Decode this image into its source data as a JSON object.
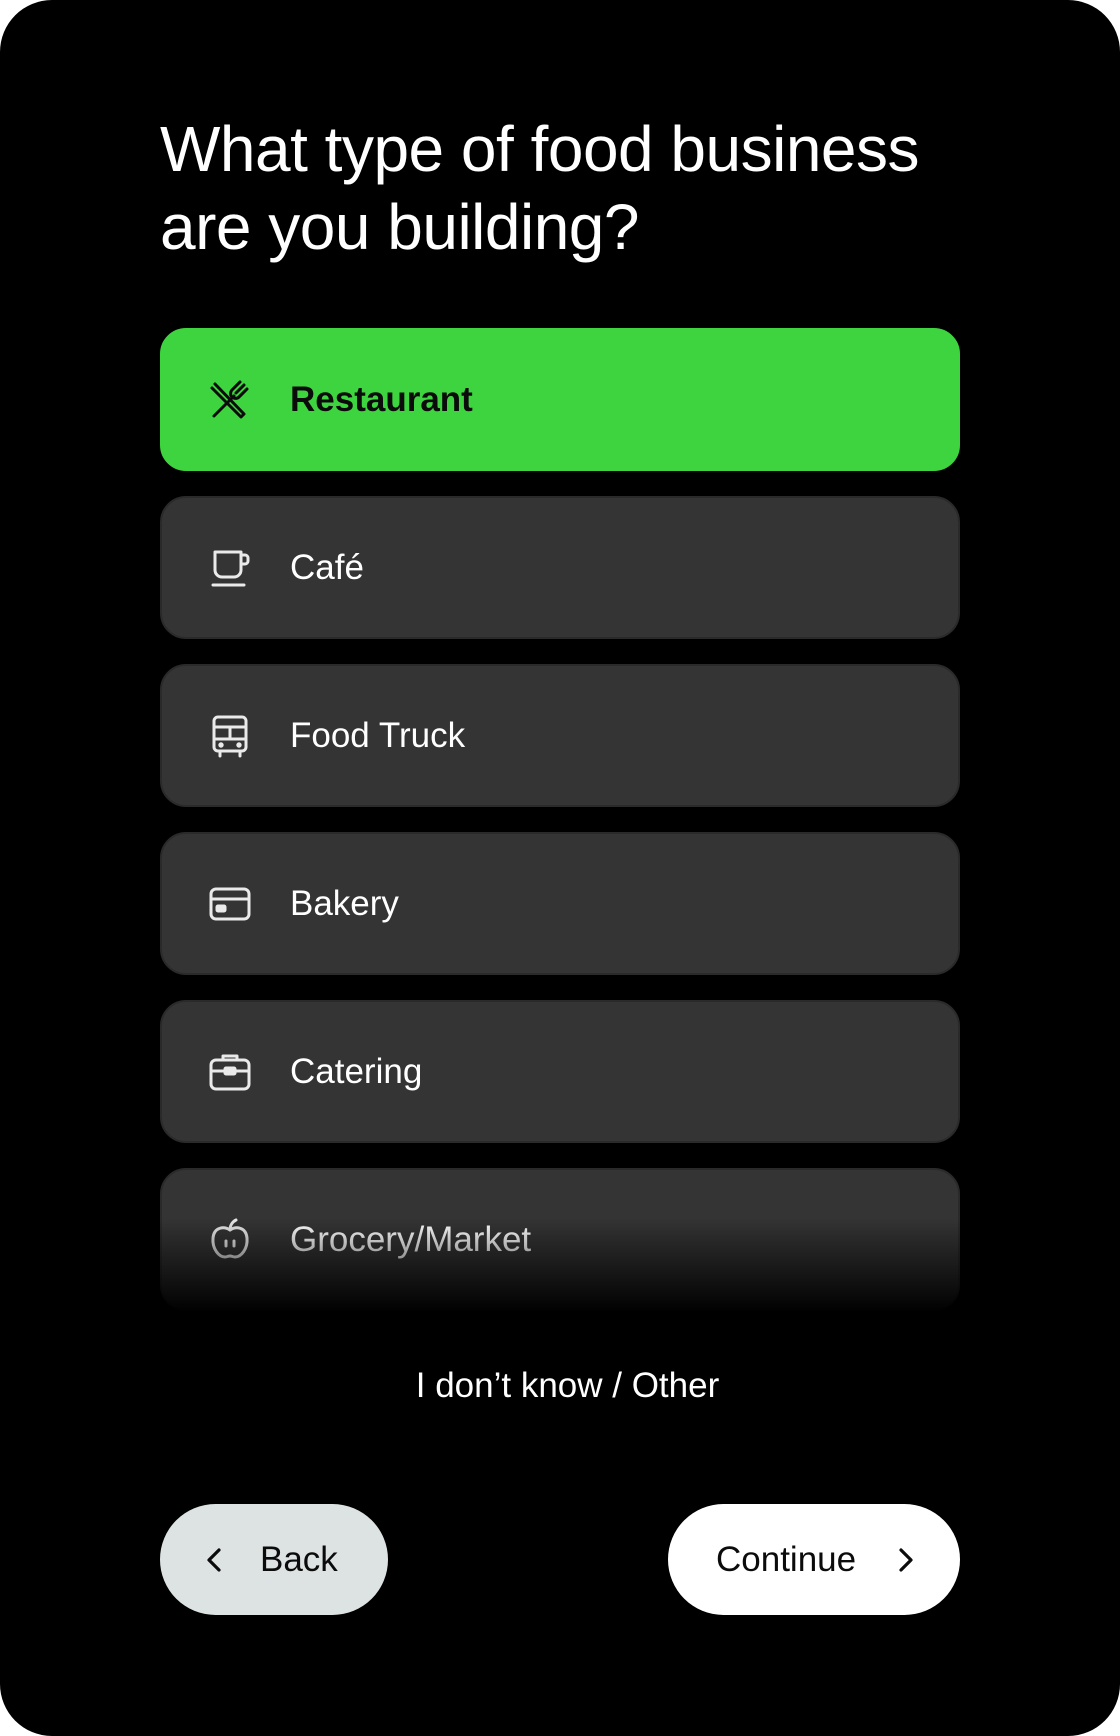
{
  "question": {
    "title_line1": "What type of food business",
    "title_line2": "are you building?"
  },
  "options": [
    {
      "label": "Restaurant",
      "icon": "fork-knife-icon",
      "selected": true
    },
    {
      "label": "Café",
      "icon": "coffee-cup-icon",
      "selected": false
    },
    {
      "label": "Food Truck",
      "icon": "truck-icon",
      "selected": false
    },
    {
      "label": "Bakery",
      "icon": "card-icon",
      "selected": false
    },
    {
      "label": "Catering",
      "icon": "briefcase-icon",
      "selected": false
    },
    {
      "label": "Grocery/Market",
      "icon": "apple-icon",
      "selected": false
    }
  ],
  "other_link": "I don’t know / Other",
  "buttons": {
    "back_label": "Back",
    "continue_label": "Continue"
  },
  "colors": {
    "background": "#000000",
    "selected_option": "#3ed43f",
    "option": "#343434",
    "back_button": "#dde2e2",
    "continue_button": "#ffffff"
  }
}
